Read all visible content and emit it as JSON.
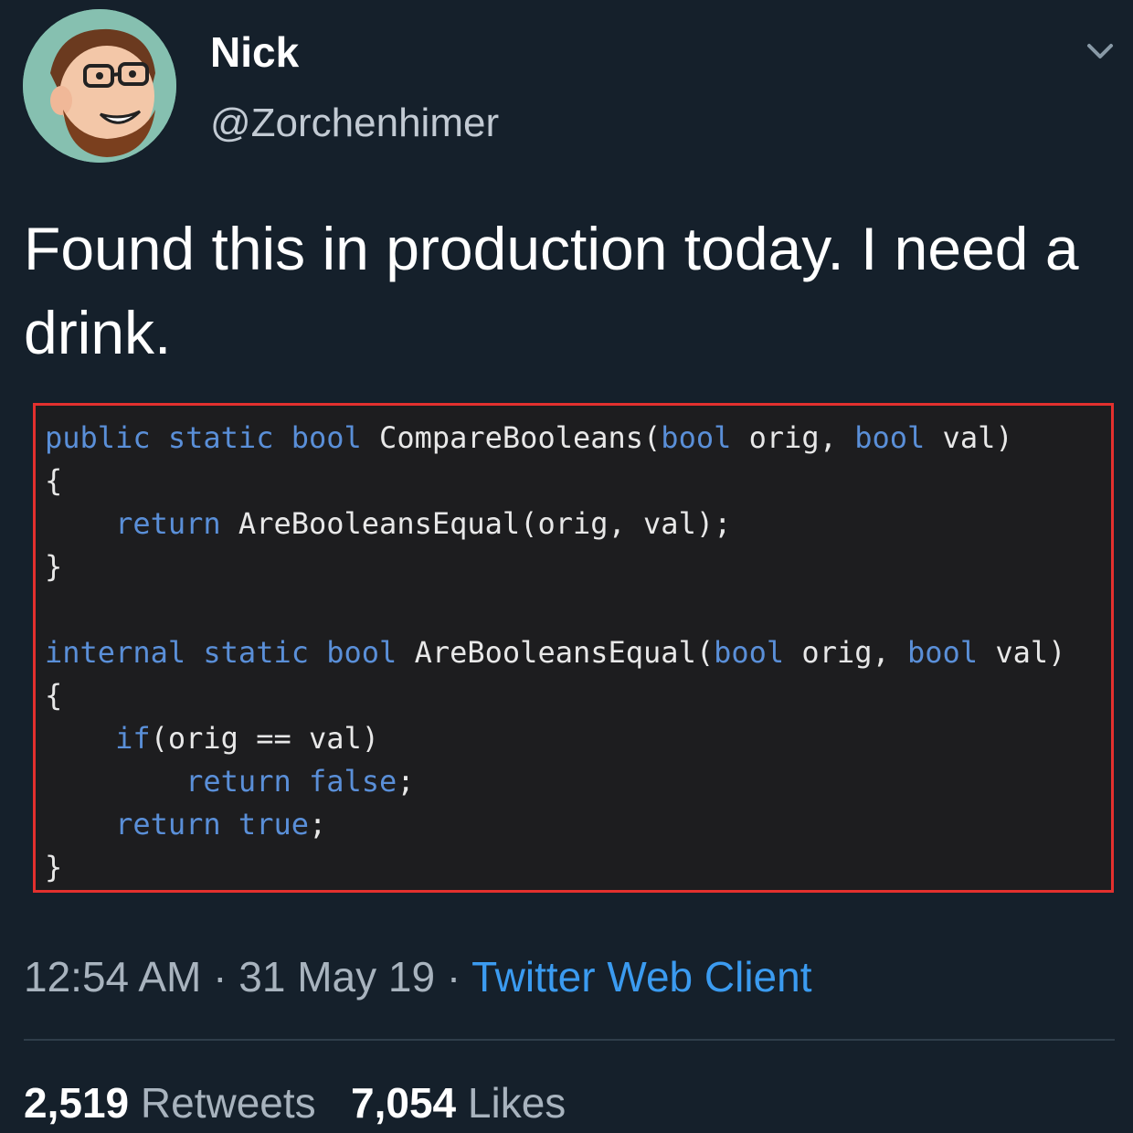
{
  "author": {
    "name": "Nick",
    "handle": "@Zorchenhimer"
  },
  "tweet": {
    "text": "Found this in production today.  I need a drink."
  },
  "code": {
    "line1": {
      "t1": "public",
      "t2": "static",
      "t3": "bool",
      "t4": "CompareBooleans(",
      "t5": "bool",
      "t6": "orig,",
      "t7": "bool",
      "t8": "val)"
    },
    "line2": {
      "t1": "{"
    },
    "line3": {
      "t1": "return",
      "t2": "AreBooleansEqual(orig, val);"
    },
    "line4": {
      "t1": "}"
    },
    "line5": {
      "t1": "internal",
      "t2": "static",
      "t3": "bool",
      "t4": "AreBooleansEqual(",
      "t5": "bool",
      "t6": "orig,",
      "t7": "bool",
      "t8": "val)"
    },
    "line6": {
      "t1": "{"
    },
    "line7": {
      "t1": "if",
      "t2": "(orig == val)"
    },
    "line8": {
      "t1": "return",
      "t2": "false",
      "t3": ";"
    },
    "line9": {
      "t1": "return",
      "t2": "true",
      "t3": ";"
    },
    "line10": {
      "t1": "}"
    }
  },
  "meta": {
    "time": "12:54 AM",
    "sep1": " · ",
    "date": "31 May 19",
    "sep2": " · ",
    "client": "Twitter Web Client"
  },
  "stats": {
    "retweets_count": "2,519",
    "retweets_label": "Retweets",
    "likes_count": "7,054",
    "likes_label": "Likes"
  },
  "colors": {
    "background": "#15202b",
    "code_border": "#e3302e",
    "keyword": "#5a8fd8",
    "link": "#3b9bf0"
  },
  "icons": {
    "avatar": "cartoon-avatar",
    "menu": "chevron-down-icon"
  }
}
